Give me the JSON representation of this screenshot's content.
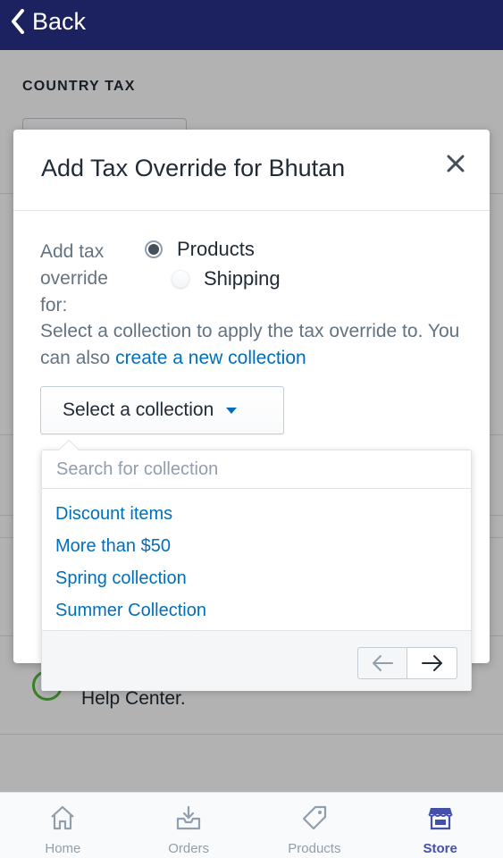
{
  "topbar": {
    "back_label": "Back"
  },
  "page": {
    "heading": "COUNTRY TAX",
    "help_text": "Help Center."
  },
  "modal": {
    "title": "Add Tax Override for Bhutan",
    "override_label": "Add tax override for:",
    "radio_options": [
      {
        "label": "Products",
        "checked": true
      },
      {
        "label": "Shipping",
        "checked": false
      }
    ],
    "description": "Select a collection to apply the tax override to. You can also",
    "create_link": "create a new collection",
    "select_label": "Select a collection"
  },
  "dropdown": {
    "search_placeholder": "Search for collection",
    "collections": [
      "Discount items",
      "More than $50",
      "Spring collection",
      "Summer Collection"
    ]
  },
  "tabbar": {
    "tabs": [
      {
        "label": "Home",
        "icon": "home-icon",
        "active": false
      },
      {
        "label": "Orders",
        "icon": "orders-icon",
        "active": false
      },
      {
        "label": "Products",
        "icon": "tag-icon",
        "active": false
      },
      {
        "label": "Store",
        "icon": "store-icon",
        "active": true
      }
    ]
  },
  "colors": {
    "topbar": "#1c2260",
    "link": "#006fbb",
    "active_tab": "#4550a8"
  }
}
